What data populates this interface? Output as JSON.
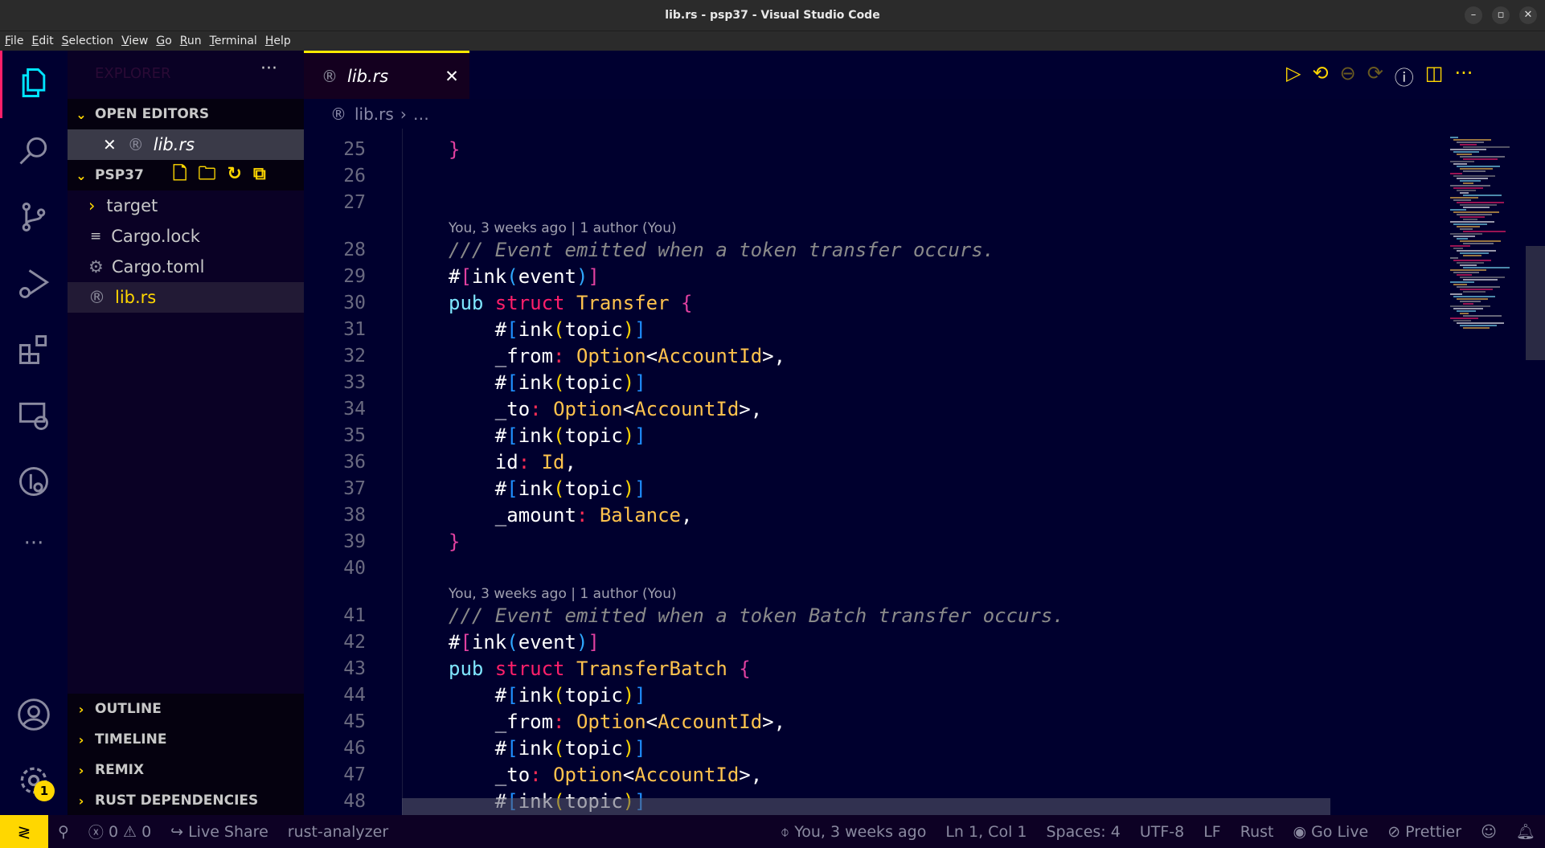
{
  "window": {
    "title": "lib.rs - psp37 - Visual Studio Code"
  },
  "menu": [
    "File",
    "Edit",
    "Selection",
    "View",
    "Go",
    "Run",
    "Terminal",
    "Help"
  ],
  "colors": {
    "accent": "#ffea00",
    "editor_bg": "#00002e",
    "sidebar_bg": "#0a0125",
    "status_bg": "#0d0124",
    "remote_bg": "#ffd700"
  },
  "activity_bar": {
    "items": [
      "files-icon",
      "search-icon",
      "source-control-icon",
      "run-debug-icon",
      "extensions-icon",
      "remote-explorer-icon",
      "git-graph-icon",
      "more-icon"
    ],
    "bottom": [
      "account-icon",
      "settings-icon"
    ],
    "settings_badge": "1"
  },
  "sidebar": {
    "title": "EXPLORER",
    "more": "···",
    "open_editors": {
      "label": "OPEN EDITORS",
      "files": [
        {
          "name": "lib.rs"
        }
      ]
    },
    "project": {
      "label": "PSP37",
      "items": [
        {
          "name": "target",
          "kind": "folder"
        },
        {
          "name": "Cargo.lock",
          "kind": "lock"
        },
        {
          "name": "Cargo.toml",
          "kind": "toml"
        },
        {
          "name": "lib.rs",
          "kind": "rust"
        }
      ]
    },
    "panels": [
      "OUTLINE",
      "TIMELINE",
      "REMIX",
      "RUST DEPENDENCIES"
    ]
  },
  "tab": {
    "label": "lib.rs"
  },
  "breadcrumb": {
    "file": "lib.rs",
    "rest": "…"
  },
  "editor": {
    "rows": [
      {
        "n": "25",
        "t": [
          [
            "b1",
            "}"
          ]
        ]
      },
      {
        "n": "26",
        "t": []
      },
      {
        "n": "27",
        "t": []
      },
      {
        "lens": "You, 3 weeks ago | 1 author (You)"
      },
      {
        "n": "28",
        "t": [
          [
            "cm",
            "/// Event emitted when a token transfer occurs."
          ]
        ]
      },
      {
        "n": "29",
        "t": [
          [
            "pl",
            "#"
          ],
          [
            "b1",
            "["
          ],
          [
            "pl",
            "ink"
          ],
          [
            "b2",
            "("
          ],
          [
            "pl",
            "event"
          ],
          [
            "b2",
            ")"
          ],
          [
            "b1",
            "]"
          ]
        ]
      },
      {
        "n": "30",
        "t": [
          [
            "kw",
            "pub "
          ],
          [
            "st",
            "struct "
          ],
          [
            "ty",
            "Transfer "
          ],
          [
            "b1",
            "{"
          ]
        ]
      },
      {
        "n": "31",
        "t": [
          [
            "pl",
            "    #"
          ],
          [
            "b3",
            "["
          ],
          [
            "pl",
            "ink"
          ],
          [
            "b4",
            "("
          ],
          [
            "pl",
            "topic"
          ],
          [
            "b4",
            ")"
          ],
          [
            "b3",
            "]"
          ]
        ]
      },
      {
        "n": "32",
        "t": [
          [
            "pl",
            "    _from"
          ],
          [
            "co",
            ": "
          ],
          [
            "ty",
            "Option"
          ],
          [
            "pl",
            "<"
          ],
          [
            "ty",
            "AccountId"
          ],
          [
            "pl",
            ">,"
          ]
        ]
      },
      {
        "n": "33",
        "t": [
          [
            "pl",
            "    #"
          ],
          [
            "b3",
            "["
          ],
          [
            "pl",
            "ink"
          ],
          [
            "b4",
            "("
          ],
          [
            "pl",
            "topic"
          ],
          [
            "b4",
            ")"
          ],
          [
            "b3",
            "]"
          ]
        ]
      },
      {
        "n": "34",
        "t": [
          [
            "pl",
            "    _to"
          ],
          [
            "co",
            ": "
          ],
          [
            "ty",
            "Option"
          ],
          [
            "pl",
            "<"
          ],
          [
            "ty",
            "AccountId"
          ],
          [
            "pl",
            ">,"
          ]
        ]
      },
      {
        "n": "35",
        "t": [
          [
            "pl",
            "    #"
          ],
          [
            "b3",
            "["
          ],
          [
            "pl",
            "ink"
          ],
          [
            "b4",
            "("
          ],
          [
            "pl",
            "topic"
          ],
          [
            "b4",
            ")"
          ],
          [
            "b3",
            "]"
          ]
        ]
      },
      {
        "n": "36",
        "t": [
          [
            "pl",
            "    id"
          ],
          [
            "co",
            ": "
          ],
          [
            "ty",
            "Id"
          ],
          [
            "pl",
            ","
          ]
        ]
      },
      {
        "n": "37",
        "t": [
          [
            "pl",
            "    #"
          ],
          [
            "b3",
            "["
          ],
          [
            "pl",
            "ink"
          ],
          [
            "b4",
            "("
          ],
          [
            "pl",
            "topic"
          ],
          [
            "b4",
            ")"
          ],
          [
            "b3",
            "]"
          ]
        ]
      },
      {
        "n": "38",
        "t": [
          [
            "pl",
            "    _amount"
          ],
          [
            "co",
            ": "
          ],
          [
            "ty",
            "Balance"
          ],
          [
            "pl",
            ","
          ]
        ]
      },
      {
        "n": "39",
        "t": [
          [
            "b1",
            "}"
          ]
        ]
      },
      {
        "n": "40",
        "t": []
      },
      {
        "lens": "You, 3 weeks ago | 1 author (You)"
      },
      {
        "n": "41",
        "t": [
          [
            "cm",
            "/// Event emitted when a token Batch transfer occurs."
          ]
        ]
      },
      {
        "n": "42",
        "t": [
          [
            "pl",
            "#"
          ],
          [
            "b1",
            "["
          ],
          [
            "pl",
            "ink"
          ],
          [
            "b2",
            "("
          ],
          [
            "pl",
            "event"
          ],
          [
            "b2",
            ")"
          ],
          [
            "b1",
            "]"
          ]
        ]
      },
      {
        "n": "43",
        "t": [
          [
            "kw",
            "pub "
          ],
          [
            "st",
            "struct "
          ],
          [
            "ty",
            "TransferBatch "
          ],
          [
            "b1",
            "{"
          ]
        ]
      },
      {
        "n": "44",
        "t": [
          [
            "pl",
            "    #"
          ],
          [
            "b3",
            "["
          ],
          [
            "pl",
            "ink"
          ],
          [
            "b4",
            "("
          ],
          [
            "pl",
            "topic"
          ],
          [
            "b4",
            ")"
          ],
          [
            "b3",
            "]"
          ]
        ]
      },
      {
        "n": "45",
        "t": [
          [
            "pl",
            "    _from"
          ],
          [
            "co",
            ": "
          ],
          [
            "ty",
            "Option"
          ],
          [
            "pl",
            "<"
          ],
          [
            "ty",
            "AccountId"
          ],
          [
            "pl",
            ">,"
          ]
        ]
      },
      {
        "n": "46",
        "t": [
          [
            "pl",
            "    #"
          ],
          [
            "b3",
            "["
          ],
          [
            "pl",
            "ink"
          ],
          [
            "b4",
            "("
          ],
          [
            "pl",
            "topic"
          ],
          [
            "b4",
            ")"
          ],
          [
            "b3",
            "]"
          ]
        ]
      },
      {
        "n": "47",
        "t": [
          [
            "pl",
            "    _to"
          ],
          [
            "co",
            ": "
          ],
          [
            "ty",
            "Option"
          ],
          [
            "pl",
            "<"
          ],
          [
            "ty",
            "AccountId"
          ],
          [
            "pl",
            ">,"
          ]
        ]
      },
      {
        "n": "48",
        "t": [
          [
            "pl",
            "    #"
          ],
          [
            "b3",
            "["
          ],
          [
            "pl",
            "ink"
          ],
          [
            "b4",
            "("
          ],
          [
            "pl",
            "topic"
          ],
          [
            "b4",
            ")"
          ],
          [
            "b3",
            "]"
          ]
        ]
      }
    ]
  },
  "status": {
    "errors": "0",
    "warnings": "0",
    "live_share": "Live Share",
    "analyzer": "rust-analyzer",
    "blame": "You, 3 weeks ago",
    "position": "Ln 1, Col 1",
    "spaces": "Spaces: 4",
    "encoding": "UTF-8",
    "eol": "LF",
    "language": "Rust",
    "go_live": "Go Live",
    "prettier": "Prettier"
  }
}
